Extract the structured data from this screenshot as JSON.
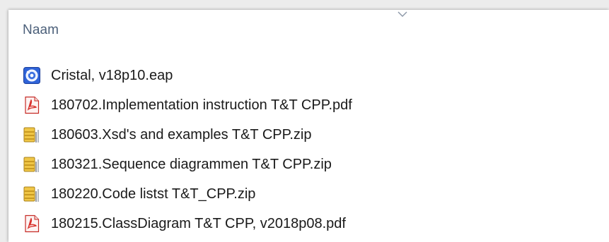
{
  "columns": {
    "name_header": "Naam"
  },
  "files": [
    {
      "name": "Cristal, v18p10.eap",
      "icon": "ea-project-icon"
    },
    {
      "name": "180702.Implementation instruction T&T CPP.pdf",
      "icon": "pdf-file-icon"
    },
    {
      "name": "180603.Xsd's and examples T&T CPP.zip",
      "icon": "zip-archive-icon"
    },
    {
      "name": "180321.Sequence diagrammen T&T CPP.zip",
      "icon": "zip-archive-icon"
    },
    {
      "name": "180220.Code listst T&T_CPP.zip",
      "icon": "zip-archive-icon"
    },
    {
      "name": "180215.ClassDiagram T&T CPP, v2018p08.pdf",
      "icon": "pdf-file-icon"
    }
  ],
  "colors": {
    "header_text": "#4c607a",
    "row_text": "#1a1a1a",
    "pdf_red": "#d8312c",
    "zip_yellow": "#e6b93a",
    "ea_blue": "#2a56c6"
  }
}
